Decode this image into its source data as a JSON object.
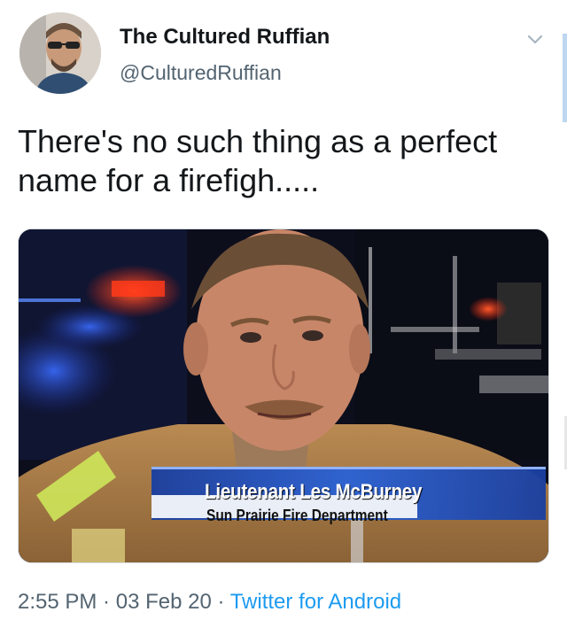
{
  "author": {
    "display_name": "The Cultured Ruffian",
    "handle": "@CulturedRuffian",
    "avatar_icon": "profile-photo"
  },
  "tweet": {
    "text": "There's no such thing as a perfect name for a firefigh....."
  },
  "media": {
    "caption_name": "Lieutenant Les McBurney",
    "caption_department": "Sun Prairie Fire Department"
  },
  "meta": {
    "time": "2:55 PM",
    "separator": " · ",
    "date": "03 Feb 20",
    "separator2": " · ",
    "source": "Twitter for Android"
  },
  "colors": {
    "link": "#1d9bf0",
    "secondary_text": "#536471",
    "lower_third_blue": "#1f4fb8"
  },
  "icons": {
    "menu": "chevron-down-icon"
  }
}
